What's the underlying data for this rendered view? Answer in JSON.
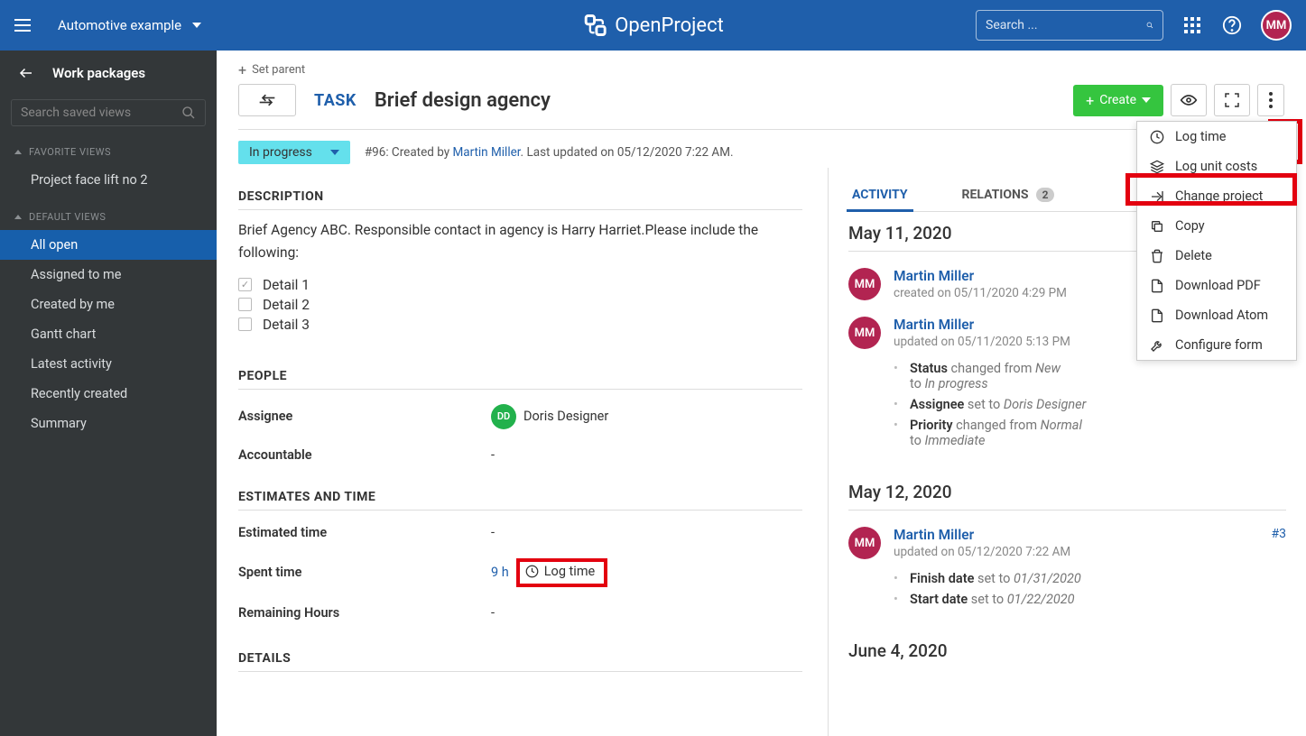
{
  "topbar": {
    "project": "Automotive example",
    "app_name": "OpenProject",
    "search_placeholder": "Search ...",
    "avatar_initials": "MM"
  },
  "sidebar": {
    "title": "Work packages",
    "search_placeholder": "Search saved views",
    "fav_header": "FAVORITE VIEWS",
    "fav_items": [
      "Project face lift no 2"
    ],
    "def_header": "DEFAULT VIEWS",
    "def_items": [
      "All open",
      "Assigned to me",
      "Created by me",
      "Gantt chart",
      "Latest activity",
      "Recently created",
      "Summary"
    ],
    "active": "All open"
  },
  "wp": {
    "set_parent": "Set parent",
    "type": "TASK",
    "title": "Brief design agency",
    "create_btn": "Create",
    "status": "In progress",
    "meta_prefix": "#96: Created by ",
    "meta_author": "Martin Miller",
    "meta_suffix": ". Last updated on 05/12/2020 7:22 AM.",
    "desc_header": "DESCRIPTION",
    "desc_text": "Brief Agency ABC. Responsible contact in agency is Harry Harriet.Please include the following:",
    "checklist": [
      {
        "label": "Detail 1",
        "checked": true
      },
      {
        "label": "Detail 2",
        "checked": false
      },
      {
        "label": "Detail 3",
        "checked": false
      }
    ],
    "people_header": "PEOPLE",
    "assignee_label": "Assignee",
    "assignee_initials": "DD",
    "assignee_name": "Doris Designer",
    "accountable_label": "Accountable",
    "accountable_value": "-",
    "estimates_header": "ESTIMATES AND TIME",
    "est_label": "Estimated time",
    "est_value": "-",
    "spent_label": "Spent time",
    "spent_value": "9 h",
    "log_time": "Log time",
    "remaining_label": "Remaining Hours",
    "remaining_value": "-",
    "details_header": "DETAILS"
  },
  "side": {
    "tab_activity": "ACTIVITY",
    "tab_relations": "RELATIONS",
    "relations_count": "2",
    "dates": [
      "May 11, 2020",
      "May 12, 2020",
      "June 4, 2020"
    ],
    "entries": [
      {
        "user": "Martin Miller",
        "initials": "MM",
        "meta": "created on 05/11/2020 4:29 PM"
      },
      {
        "user": "Martin Miller",
        "initials": "MM",
        "meta": "updated on 05/11/2020 5:13 PM"
      },
      {
        "user": "Martin Miller",
        "initials": "MM",
        "meta": "updated on 05/12/2020 7:22 AM",
        "link": "#3"
      }
    ],
    "changes1": [
      {
        "field": "Status",
        "text": " changed from ",
        "val1": "New",
        "mid": " to ",
        "val2": "In progress"
      },
      {
        "field": "Assignee",
        "text": " set to ",
        "val1": "Doris Designer"
      },
      {
        "field": "Priority",
        "text": " changed from ",
        "val1": "Normal",
        "mid": " to ",
        "val2": "Immediate"
      }
    ],
    "changes2": [
      {
        "field": "Finish date",
        "text": " set to ",
        "val1": "01/31/2020"
      },
      {
        "field": "Start date",
        "text": " set to ",
        "val1": "01/22/2020"
      }
    ]
  },
  "menu": {
    "items": [
      "Log time",
      "Log unit costs",
      "Change project",
      "Copy",
      "Delete",
      "Download PDF",
      "Download Atom",
      "Configure form"
    ]
  }
}
